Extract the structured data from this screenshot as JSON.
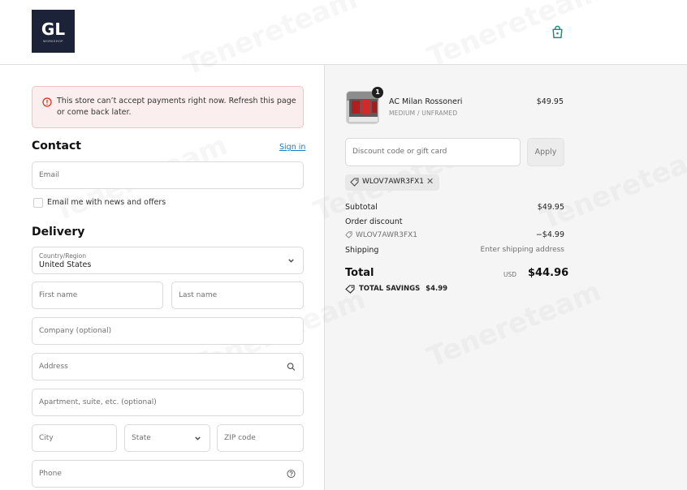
{
  "header": {
    "logo_text": "GL",
    "logo_subtext": "WORKSHOP",
    "cart_icon": "shopping-bag-icon"
  },
  "alert": {
    "icon": "error-circle-icon",
    "message": "This store can’t accept payments right now. Refresh this page or come back later."
  },
  "contact": {
    "heading": "Contact",
    "signin_label": "Sign in",
    "email_placeholder": "Email",
    "newsletter_label": "Email me with news and offers"
  },
  "delivery": {
    "heading": "Delivery",
    "country_label": "Country/Region",
    "country_value": "United States",
    "first_name_placeholder": "First name",
    "last_name_placeholder": "Last name",
    "company_placeholder": "Company (optional)",
    "address_placeholder": "Address",
    "apartment_placeholder": "Apartment, suite, etc. (optional)",
    "city_placeholder": "City",
    "state_placeholder": "State",
    "zip_placeholder": "ZIP code",
    "phone_placeholder": "Phone"
  },
  "summary": {
    "product": {
      "name": "AC Milan Rossoneri",
      "variant": "MEDIUM / UNFRAMED",
      "price": "$49.95",
      "quantity": "1"
    },
    "discount_placeholder": "Discount code or gift card",
    "apply_label": "Apply",
    "applied_code": "WLOV7AWR3FX1",
    "subtotal_label": "Subtotal",
    "subtotal_value": "$49.95",
    "order_discount_label": "Order discount",
    "discount_code": "WLOV7AWR3FX1",
    "discount_value": "−$4.99",
    "shipping_label": "Shipping",
    "shipping_value": "Enter shipping address",
    "total_label": "Total",
    "currency": "USD",
    "total_value": "$44.96",
    "savings_label": "TOTAL SAVINGS",
    "savings_value": "$4.99"
  },
  "colors": {
    "accent": "#197bbd",
    "alert_bg": "#fbeeee",
    "alert_border": "#f1c4c4",
    "error": "#d72c0d",
    "logo_bg": "#1c2238",
    "cart_icon": "#1d8a7a"
  }
}
